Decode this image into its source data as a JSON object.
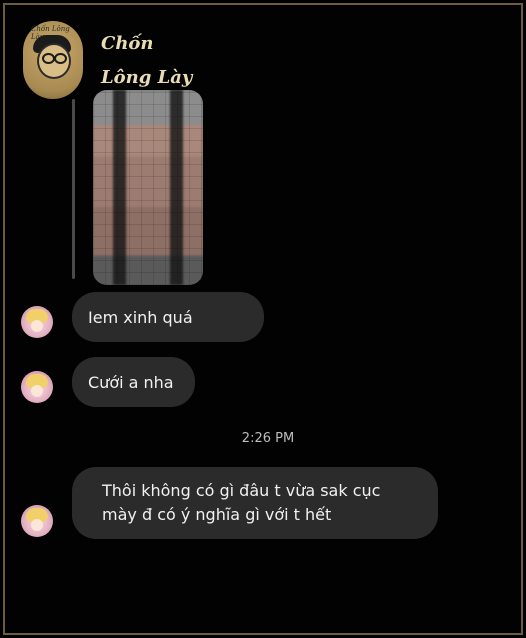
{
  "watermark": {
    "brand_line1": "Chốn",
    "brand_line2": "Lông Lày",
    "mini_text": "Chốn Lông Lày"
  },
  "conversation": {
    "messages": [
      {
        "text": "Iem xinh quá"
      },
      {
        "text": "Cưới a nha"
      },
      {
        "text": "Thôi không có gì đâu t vừa sak cục\nmày đ có ý nghĩa gì với t hết"
      }
    ],
    "timestamp": "2:26 PM"
  },
  "colors": {
    "background": "#020202",
    "bubble": "#2b2b2b",
    "frame": "#6e5d3c"
  }
}
